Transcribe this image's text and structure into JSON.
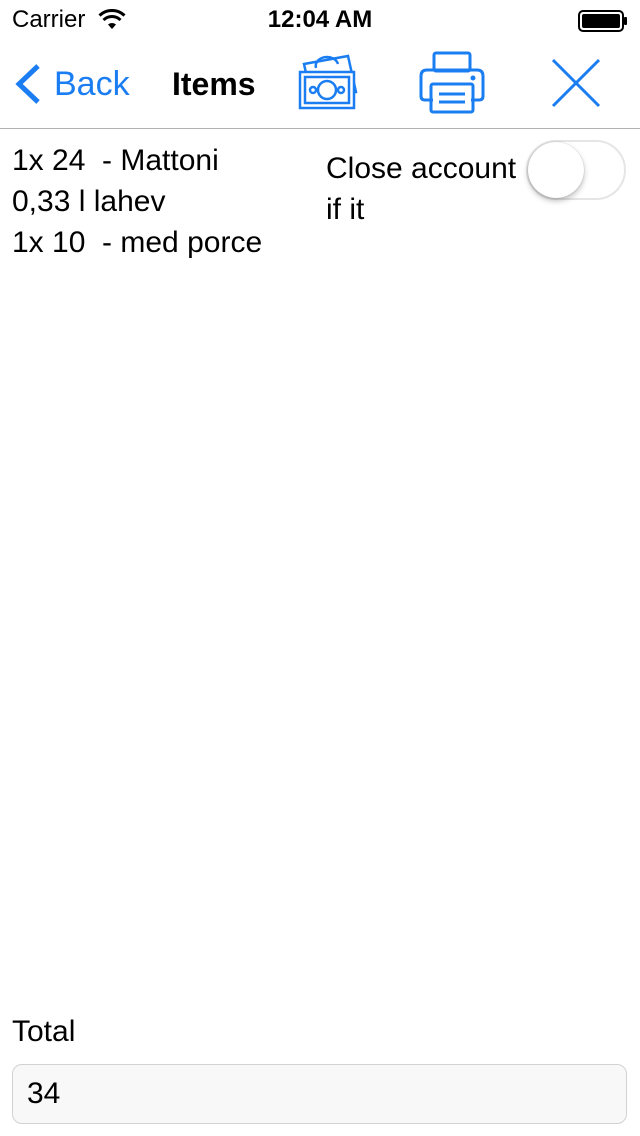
{
  "status_bar": {
    "carrier": "Carrier",
    "time": "12:04 AM"
  },
  "nav": {
    "back_label": "Back",
    "title": "Items",
    "icons": [
      "cash-icon",
      "print-icon",
      "close-icon"
    ],
    "accent_color": "#1a7df2"
  },
  "items": [
    "1x 24  - Mattoni",
    "0,33 l lahev",
    "1x 10  - med porce"
  ],
  "close_account": {
    "label": "Close account if it",
    "toggle_on": false
  },
  "total": {
    "label": "Total",
    "value": "34"
  }
}
